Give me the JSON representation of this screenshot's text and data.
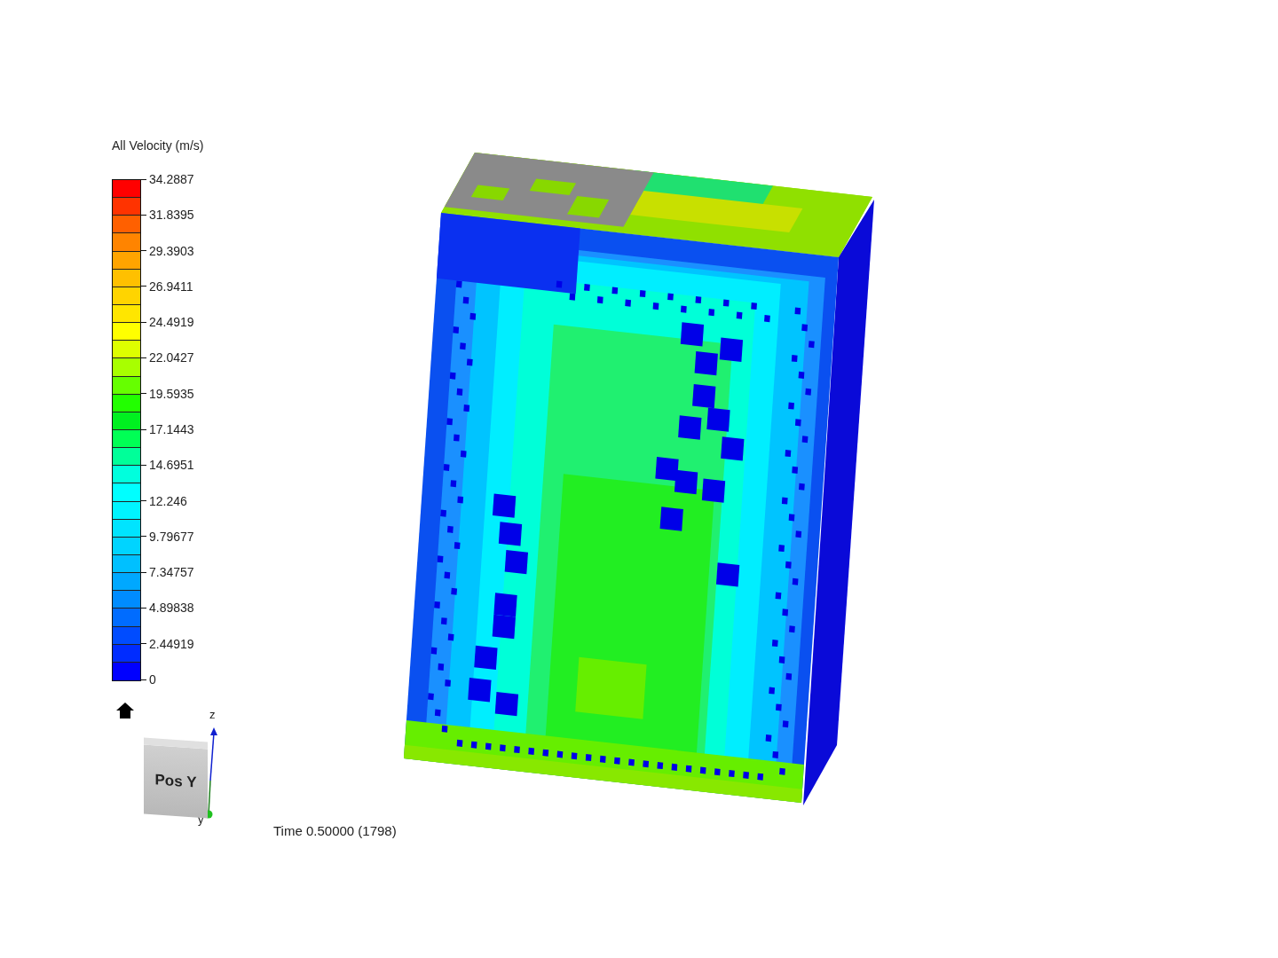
{
  "legend": {
    "title": "All Velocity (m/s)",
    "bands": [
      {
        "color": "#ff0000"
      },
      {
        "color": "#ff3300"
      },
      {
        "color": "#ff6000"
      },
      {
        "color": "#ff8400"
      },
      {
        "color": "#ffa400"
      },
      {
        "color": "#ffc000"
      },
      {
        "color": "#ffd400"
      },
      {
        "color": "#ffe600"
      },
      {
        "color": "#ffff00"
      },
      {
        "color": "#deff00"
      },
      {
        "color": "#a8ff00"
      },
      {
        "color": "#66ff00"
      },
      {
        "color": "#22ff00"
      },
      {
        "color": "#00f020"
      },
      {
        "color": "#00ff55"
      },
      {
        "color": "#00ff99"
      },
      {
        "color": "#00ffdd"
      },
      {
        "color": "#00ffff"
      },
      {
        "color": "#00f4ff"
      },
      {
        "color": "#00e4ff"
      },
      {
        "color": "#00d4ff"
      },
      {
        "color": "#00c0ff"
      },
      {
        "color": "#00a8ff"
      },
      {
        "color": "#008cff"
      },
      {
        "color": "#006cff"
      },
      {
        "color": "#004cff"
      },
      {
        "color": "#002cff"
      },
      {
        "color": "#0000ff"
      }
    ],
    "ticks": [
      "34.2887",
      "31.8395",
      "29.3903",
      "26.9411",
      "24.4919",
      "22.0427",
      "19.5935",
      "17.1443",
      "14.6951",
      "12.246",
      "9.79677",
      "7.34757",
      "4.89838",
      "2.44919",
      "0"
    ]
  },
  "view_cube": {
    "face_label": "Pos Y",
    "axis_z": "z",
    "axis_y": "y"
  },
  "time_label": "Time 0.50000 (1798)"
}
